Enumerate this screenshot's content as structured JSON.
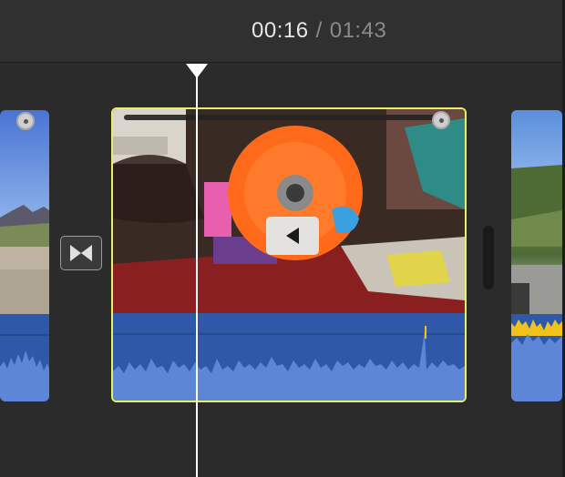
{
  "timecode": {
    "current": "00:16",
    "separator": "/",
    "total": "01:43"
  },
  "colors": {
    "background": "#2b2b2b",
    "selection": "#e7f06a",
    "audio": "#2f58a8",
    "audio_peak": "#f1c21b",
    "playhead": "#ffffff"
  },
  "icons": {
    "playhead": "playhead-triangle-icon",
    "transition": "transition-bowtie-icon",
    "reverse": "reverse-play-icon",
    "clip_handle": "clip-handle-dot-icon"
  },
  "clips": [
    {
      "name": "clip-mountain-left",
      "selected": false
    },
    {
      "name": "clip-skateboard-wheel",
      "selected": true,
      "reversed": true
    },
    {
      "name": "clip-mountain-right",
      "selected": false
    }
  ],
  "playhead_time": "00:16"
}
